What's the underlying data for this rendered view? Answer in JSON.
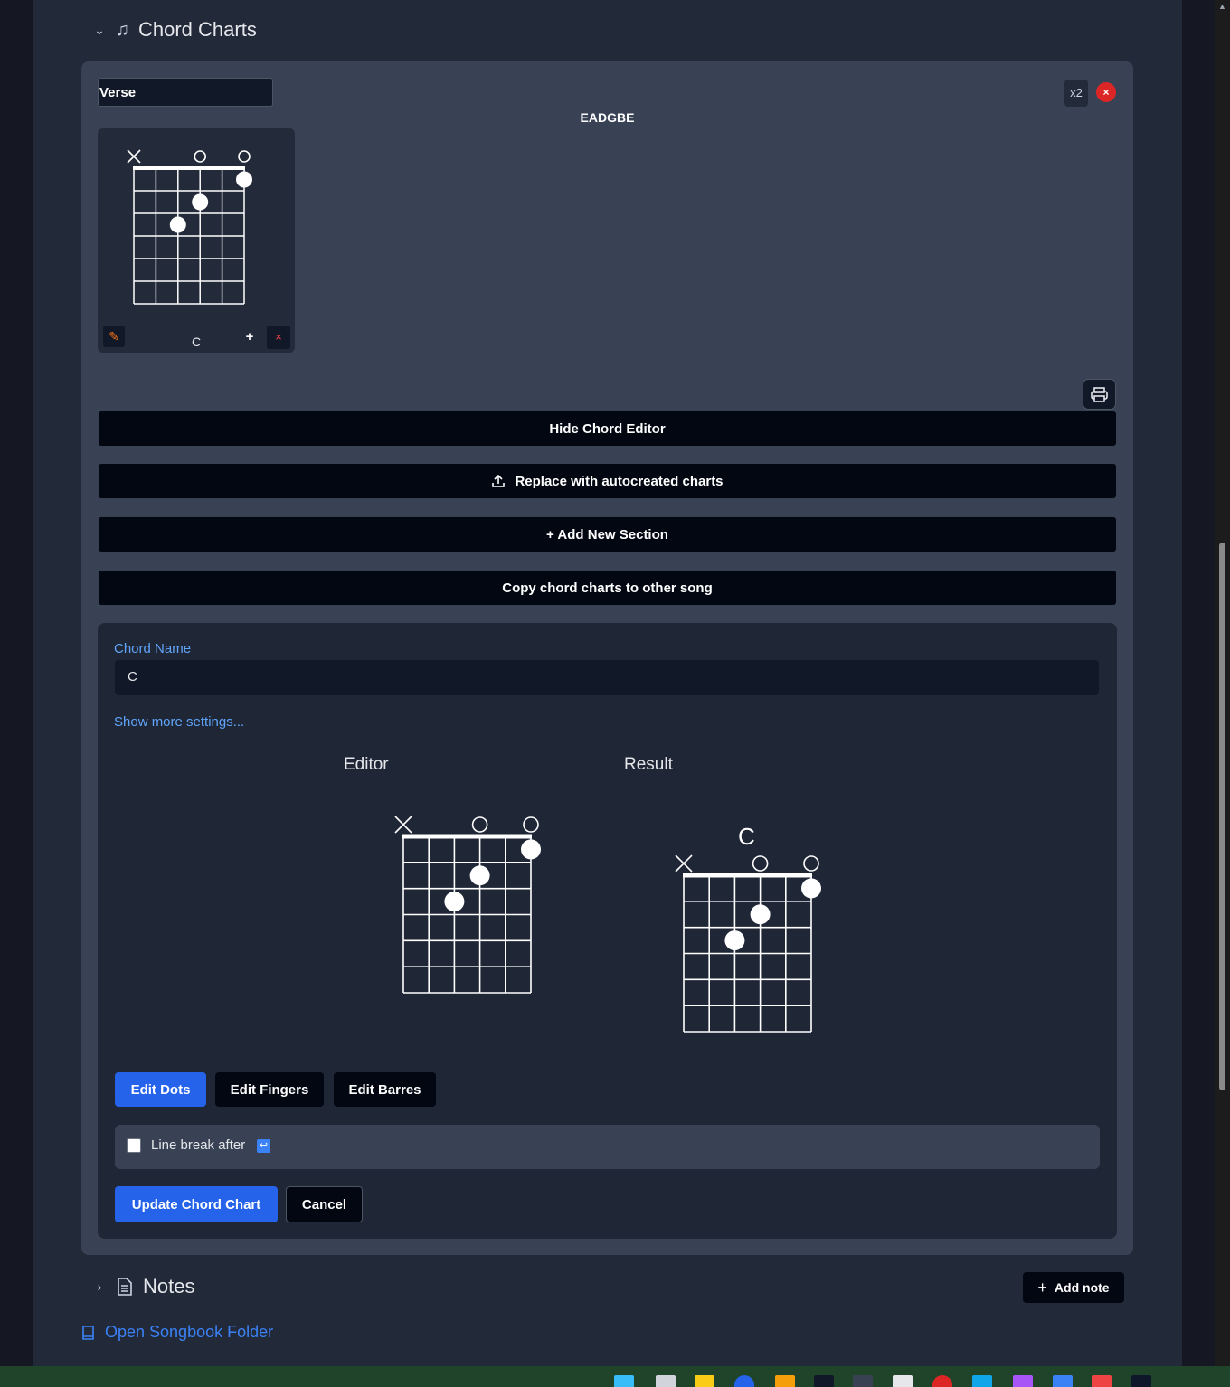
{
  "chord_charts_section": {
    "title": "Chord Charts",
    "chevron": "chevron-down-icon",
    "icon": "music-note-icon"
  },
  "section_card": {
    "name_value": "Verse",
    "repeat_label": "x2",
    "remove_symbol": "×",
    "tuning": "EADGBE"
  },
  "mini_chart": {
    "chord_name": "C",
    "edit_icon": "pencil-icon",
    "add_symbol": "+",
    "delete_symbol": "×"
  },
  "chord_shape": {
    "string_markers": [
      "x",
      "",
      "",
      "o",
      "",
      "o"
    ],
    "dots": [
      {
        "string": 2,
        "fret": 3
      },
      {
        "string": 3,
        "fret": 2
      },
      {
        "string": 5,
        "fret": 1
      }
    ]
  },
  "buttons": {
    "hide_editor": "Hide Chord Editor",
    "replace_autocreated": "Replace with autocreated charts",
    "add_section": "+ Add New Section",
    "copy_charts": "Copy chord charts to other song"
  },
  "editor": {
    "chord_name_label": "Chord Name",
    "chord_name_value": "C",
    "show_more": "Show more settings...",
    "editor_title": "Editor",
    "result_title": "Result",
    "result_chord_name": "C",
    "tabs": [
      "Edit Dots",
      "Edit Fingers",
      "Edit Barres"
    ],
    "active_tab": "Edit Dots",
    "line_break_label": "Line break after",
    "line_break_checked": false,
    "update_label": "Update Chord Chart",
    "cancel_label": "Cancel"
  },
  "notes_section": {
    "title": "Notes",
    "chevron": "chevron-right-icon",
    "icon": "document-icon",
    "add_note_label": "Add note"
  },
  "open_folder_label": "Open Songbook Folder",
  "colors": {
    "accent_blue": "#2563eb",
    "link_blue": "#60a5fa",
    "danger_red": "#dc2626",
    "card_bg": "#384254",
    "button_black": "#030712"
  }
}
